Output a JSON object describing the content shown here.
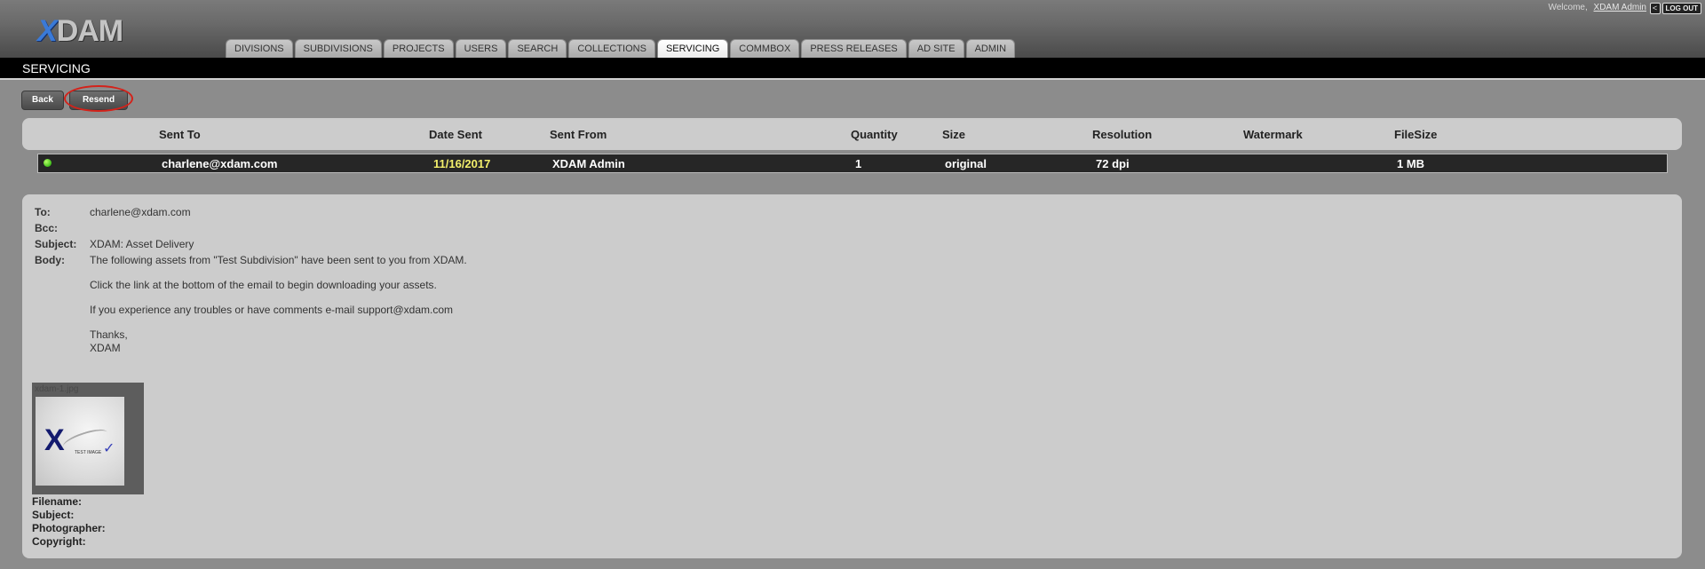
{
  "header": {
    "logo_x": "X",
    "logo_rest": "DAM",
    "welcome_prefix": "Welcome,",
    "welcome_user": "XDAM Admin",
    "logout_arrow": "<",
    "logout_label": "LOG OUT"
  },
  "nav": {
    "tabs": [
      {
        "label": "DIVISIONS"
      },
      {
        "label": "SUBDIVISIONS"
      },
      {
        "label": "PROJECTS"
      },
      {
        "label": "USERS"
      },
      {
        "label": "SEARCH"
      },
      {
        "label": "COLLECTIONS"
      },
      {
        "label": "SERVICING",
        "active": true
      },
      {
        "label": "COMMBOX"
      },
      {
        "label": "PRESS RELEASES"
      },
      {
        "label": "AD SITE"
      },
      {
        "label": "ADMIN"
      }
    ]
  },
  "page": {
    "title": "SERVICING",
    "back_label": "Back",
    "resend_label": "Resend"
  },
  "table": {
    "headers": {
      "sent_to": "Sent To",
      "date_sent": "Date Sent",
      "sent_from": "Sent From",
      "quantity": "Quantity",
      "size": "Size",
      "resolution": "Resolution",
      "watermark": "Watermark",
      "filesize": "FileSize"
    },
    "rows": [
      {
        "status_color": "#3fbf1a",
        "sent_to": "charlene@xdam.com",
        "date_sent": "11/16/2017",
        "sent_from": "XDAM Admin",
        "quantity": "1",
        "size": "original",
        "resolution": "72 dpi",
        "watermark": "",
        "filesize": "1 MB"
      }
    ]
  },
  "email": {
    "to_label": "To:",
    "to": "charlene@xdam.com",
    "bcc_label": "Bcc:",
    "bcc": "",
    "subject_label": "Subject:",
    "subject": "XDAM: Asset Delivery",
    "body_label": "Body:",
    "body_lines": [
      "The following assets from \"Test Subdivision\" have been sent to you from XDAM.",
      "Click the link at the bottom of the email to begin downloading your assets.",
      "If you experience any troubles or have comments e-mail support@xdam.com",
      "Thanks,",
      "XDAM"
    ]
  },
  "asset": {
    "filename_caption": "xdam-1.jpg",
    "image_text": "TEST IMAGE",
    "meta": {
      "filename_label": "Filename:",
      "subject_label": "Subject:",
      "photographer_label": "Photographer:",
      "copyright_label": "Copyright:"
    }
  }
}
